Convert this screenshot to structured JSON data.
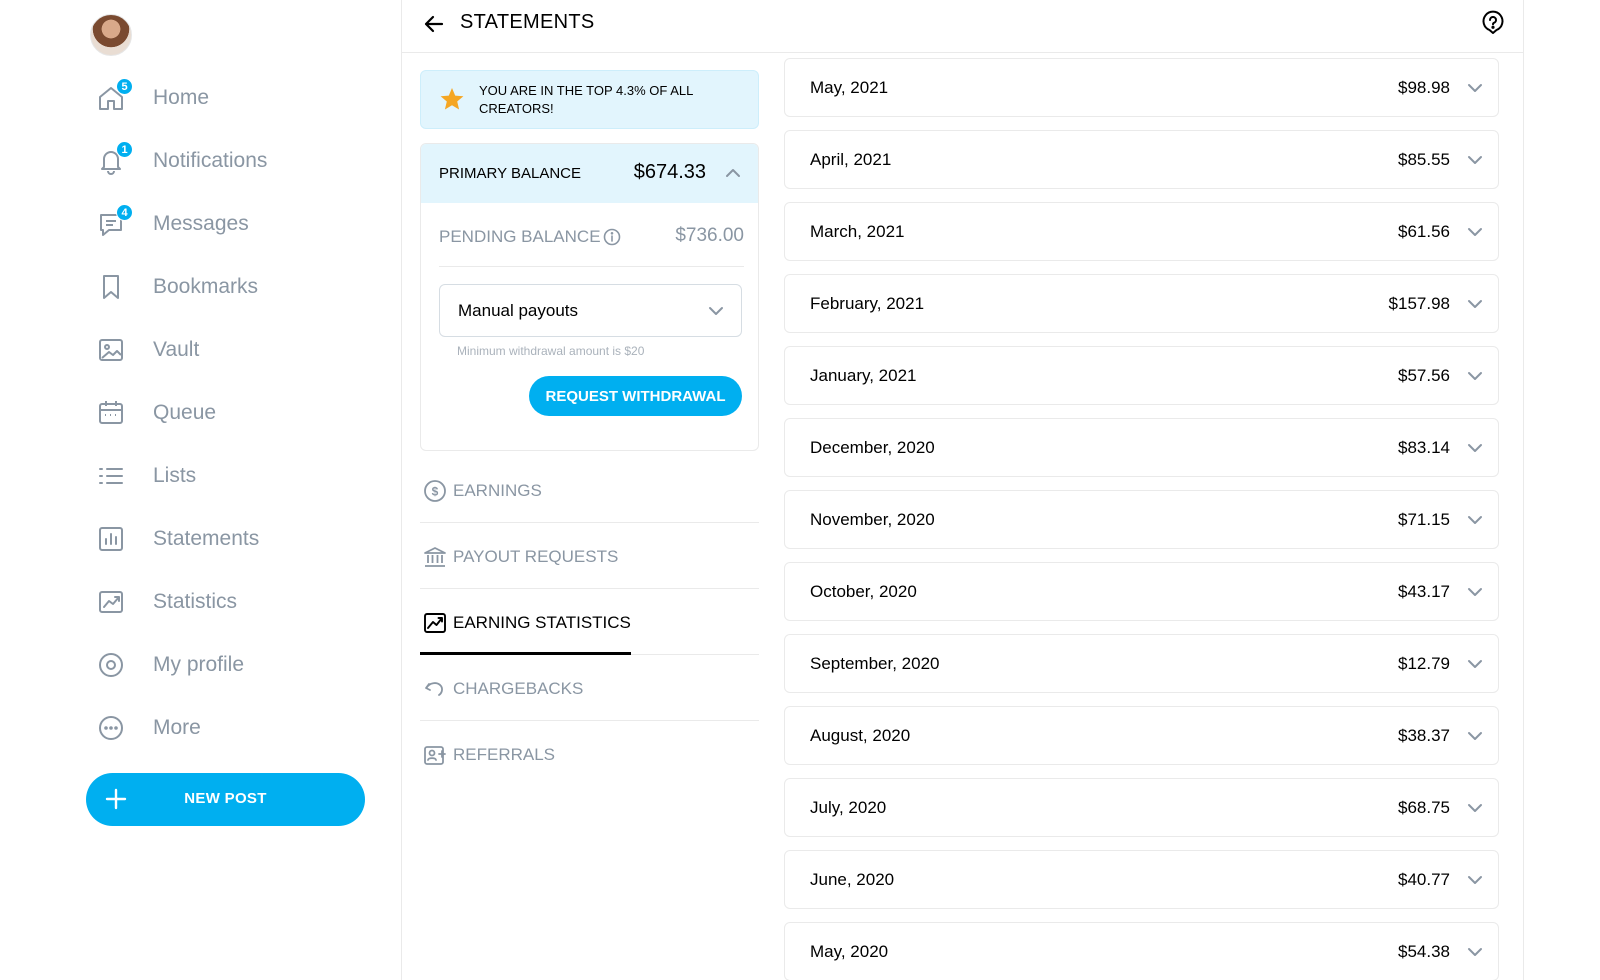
{
  "sidebar": {
    "items": [
      {
        "label": "Home",
        "icon": "home-icon",
        "badge": "5"
      },
      {
        "label": "Notifications",
        "icon": "bell-icon",
        "badge": "1"
      },
      {
        "label": "Messages",
        "icon": "message-icon",
        "badge": "4"
      },
      {
        "label": "Bookmarks",
        "icon": "bookmark-icon"
      },
      {
        "label": "Vault",
        "icon": "image-icon"
      },
      {
        "label": "Queue",
        "icon": "calendar-icon"
      },
      {
        "label": "Lists",
        "icon": "list-icon"
      },
      {
        "label": "Statements",
        "icon": "bar-chart-icon"
      },
      {
        "label": "Statistics",
        "icon": "trend-chart-icon"
      },
      {
        "label": "My profile",
        "icon": "profile-icon"
      },
      {
        "label": "More",
        "icon": "more-icon"
      }
    ],
    "new_post_label": "NEW POST"
  },
  "header": {
    "title": "STATEMENTS"
  },
  "banner": {
    "text": "YOU ARE IN THE TOP 4.3% OF ALL CREATORS!"
  },
  "balance": {
    "primary_label": "PRIMARY BALANCE",
    "primary_amount": "$674.33",
    "pending_label": "PENDING BALANCE",
    "pending_amount": "$736.00",
    "payout_mode": "Manual payouts",
    "min_note": "Minimum withdrawal amount is $20",
    "withdraw_label": "REQUEST WITHDRAWAL"
  },
  "tabs": [
    {
      "label": "EARNINGS",
      "icon": "dollar-circle-icon"
    },
    {
      "label": "PAYOUT REQUESTS",
      "icon": "bank-icon"
    },
    {
      "label": "EARNING STATISTICS",
      "icon": "chart-icon"
    },
    {
      "label": "CHARGEBACKS",
      "icon": "undo-icon"
    },
    {
      "label": "REFERRALS",
      "icon": "referral-icon"
    }
  ],
  "statements": [
    {
      "month": "May, 2021",
      "amount": "$98.98"
    },
    {
      "month": "April, 2021",
      "amount": "$85.55"
    },
    {
      "month": "March, 2021",
      "amount": "$61.56"
    },
    {
      "month": "February, 2021",
      "amount": "$157.98"
    },
    {
      "month": "January, 2021",
      "amount": "$57.56"
    },
    {
      "month": "December, 2020",
      "amount": "$83.14"
    },
    {
      "month": "November, 2020",
      "amount": "$71.15"
    },
    {
      "month": "October, 2020",
      "amount": "$43.17"
    },
    {
      "month": "September, 2020",
      "amount": "$12.79"
    },
    {
      "month": "August, 2020",
      "amount": "$38.37"
    },
    {
      "month": "July, 2020",
      "amount": "$68.75"
    },
    {
      "month": "June, 2020",
      "amount": "$40.77"
    },
    {
      "month": "May, 2020",
      "amount": "$54.38"
    }
  ],
  "colors": {
    "accent": "#00aff0",
    "muted": "#8a96a3",
    "highlight_bg": "#e2f5fd",
    "star": "#f5a623"
  }
}
